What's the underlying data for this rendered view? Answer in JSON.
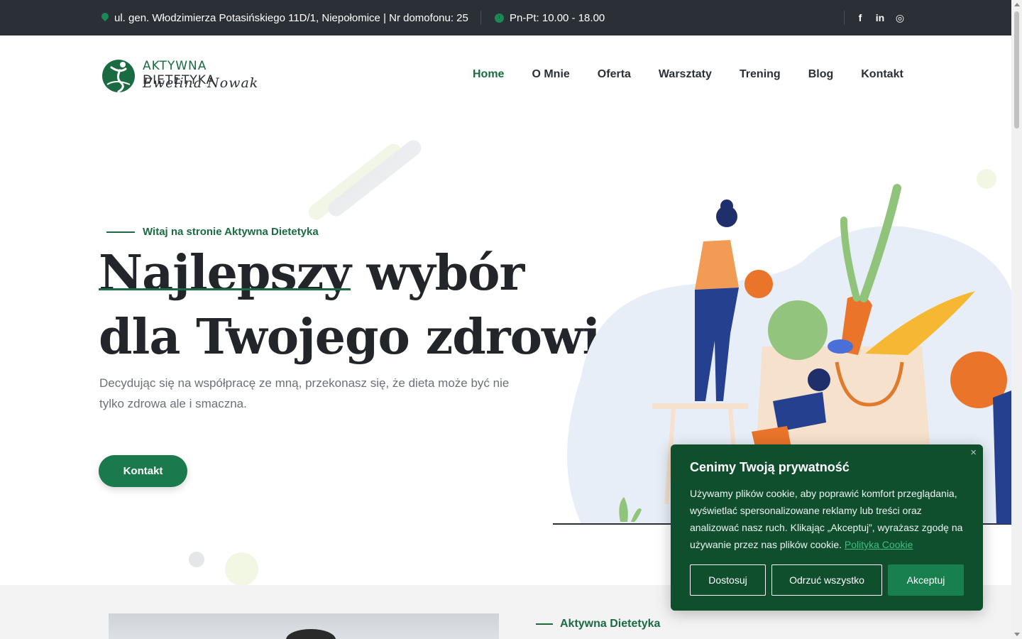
{
  "topbar": {
    "address": "ul. gen. Włodzimierza Potasińskiego 11D/1, Niepołomice | Nr domofonu: 25",
    "hours": "Pn-Pt: 10.00 - 18.00",
    "socials": [
      "f",
      "in",
      "◎"
    ]
  },
  "logo": {
    "name_first": "AKTYWNA",
    "name_second": "DIETETYKA",
    "signature": "Ewelina Nowak"
  },
  "nav": {
    "items": [
      "Home",
      "O Mnie",
      "Oferta",
      "Warsztaty",
      "Trening",
      "Blog",
      "Kontakt"
    ],
    "active": "Home"
  },
  "hero": {
    "eyebrow": "Witaj na stronie Aktywna Dietetyka",
    "title_line1_underlined": "Najlepszy",
    "title_line1_rest": " wybór",
    "title_line2": "dla Twojego zdrowia",
    "lead": "Decydując się na współpracę ze mną, przekonasz się, że dieta może być nie tylko zdrowa ale i smaczna.",
    "button": "Kontakt"
  },
  "section2": {
    "title": "Aktywna Dietetyka"
  },
  "cookie": {
    "close": "×",
    "title": "Cenimy Twoją prywatność",
    "text": "Używamy plików cookie, aby poprawić komfort przeglądania, wyświetlać spersonalizowane reklamy lub treści oraz analizować nasz ruch. Klikając „Akceptuj”, wyrażasz zgodę na używanie przez nas plików cookie. ",
    "link": "Polityka Cookie",
    "btn_customize": "Dostosuj",
    "btn_reject": "Odrzuć wszystko",
    "btn_accept": "Akceptuj"
  },
  "colors": {
    "brand": "#1a6b42",
    "topbar": "#2b2f36",
    "cookie_bg": "#0f4f2e",
    "cookie_accept": "#18804e"
  }
}
